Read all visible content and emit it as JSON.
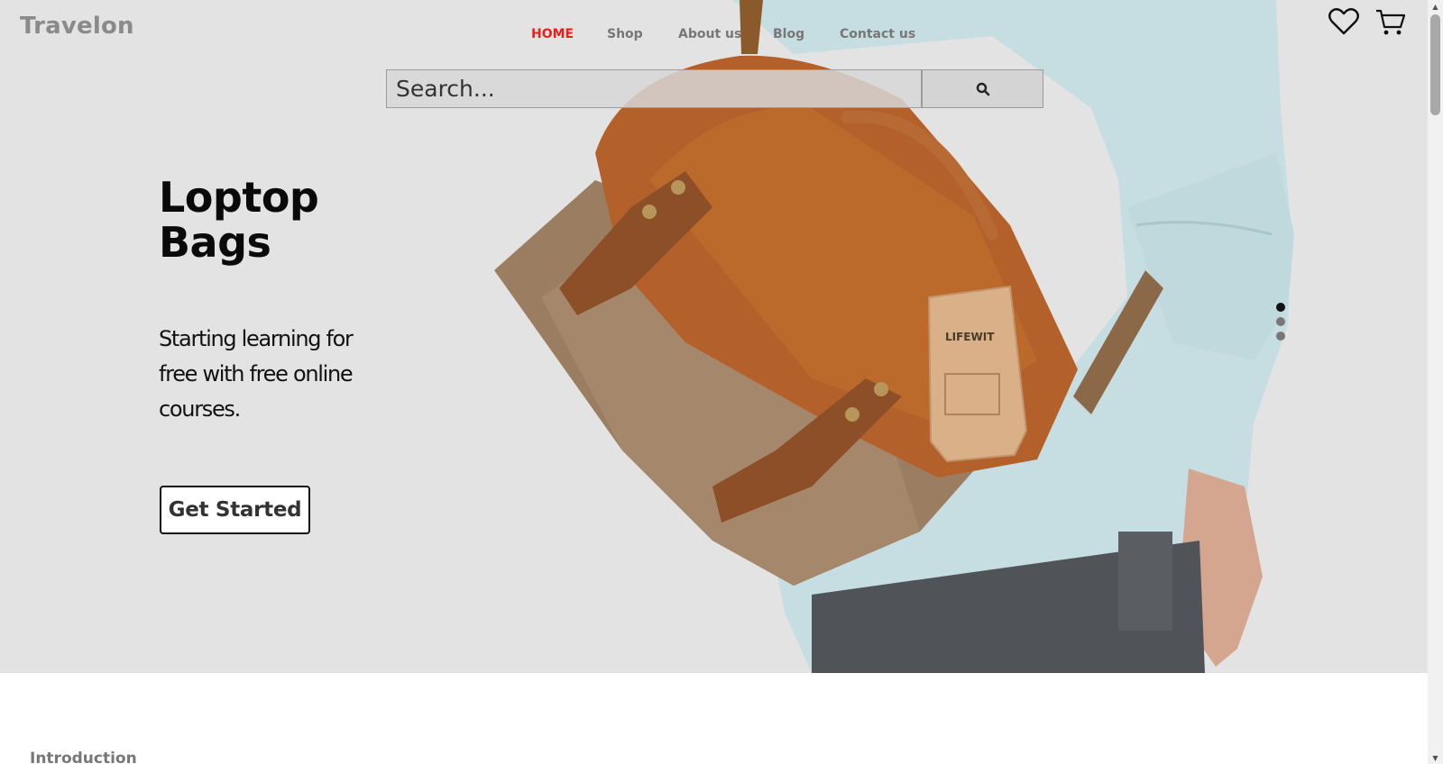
{
  "brand": {
    "name": "Travelon"
  },
  "nav": {
    "items": [
      {
        "label": "HOME",
        "active": true
      },
      {
        "label": "Shop",
        "active": false
      },
      {
        "label": "About us",
        "active": false
      },
      {
        "label": "Blog",
        "active": false
      },
      {
        "label": "Contact us",
        "active": false
      }
    ],
    "active_color": "#e8201d"
  },
  "header_icons": [
    "heart-icon",
    "cart-icon"
  ],
  "search": {
    "placeholder": "Search...",
    "button_icon": "search-icon"
  },
  "hero": {
    "title": "Loptop Bags",
    "subtitle": "Starting learning for free with free online courses.",
    "cta_label": "Get Started",
    "tag_text": "LIFEWIT",
    "slides": {
      "count": 3,
      "active_index": 0
    }
  },
  "next_section": {
    "label": "Introduction"
  },
  "colors": {
    "hero_bg": "#e3e3e3",
    "brand_gray": "#8a8a8a",
    "bag_leather": "#b5612a",
    "shirt": "#c5dde0"
  }
}
